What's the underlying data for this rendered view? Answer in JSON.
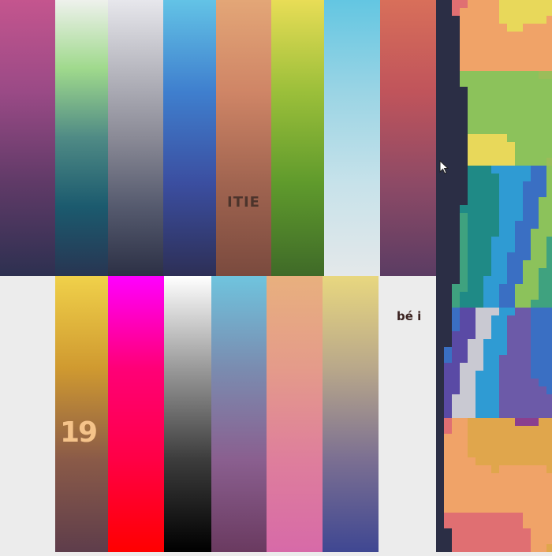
{
  "top_row": [
    {
      "name": "strip-1",
      "colors": [
        "#c4558e",
        "#9a4a86",
        "#5f3a67",
        "#2d3050"
      ]
    },
    {
      "name": "strip-2",
      "colors": [
        "#eef1ec",
        "#9fd98c",
        "#4f8a85",
        "#1b5a6e",
        "#283552"
      ]
    },
    {
      "name": "strip-3",
      "colors": [
        "#e7e7ec",
        "#b8b8c0",
        "#8a8a96",
        "#555a6e",
        "#2c3045"
      ]
    },
    {
      "name": "strip-4",
      "colors": [
        "#63c3e6",
        "#3f7fce",
        "#3b4ea0",
        "#2d2f56"
      ]
    },
    {
      "name": "strip-5",
      "colors": [
        "#e3a677",
        "#cf8566",
        "#a06450",
        "#7a4a3e"
      ]
    },
    {
      "name": "strip-6",
      "colors": [
        "#e8dd56",
        "#9bbf3a",
        "#5f9a2c",
        "#3f6a28"
      ]
    },
    {
      "name": "strip-7",
      "colors": [
        "#63c6e2",
        "#9ad4e4",
        "#c7e2ea",
        "#e4e8ea"
      ]
    },
    {
      "name": "strip-8",
      "colors": [
        "#d86f5a",
        "#c0545b",
        "#8d4a66",
        "#5b3c63"
      ]
    }
  ],
  "bottom_row": [
    {
      "name": "strip-9",
      "colors": [
        "#ececec",
        "#ececec"
      ]
    },
    {
      "name": "strip-10",
      "colors": [
        "#f0d14a",
        "#d09a30",
        "#8a5a48",
        "#5e3d4b"
      ]
    },
    {
      "name": "strip-11",
      "colors": [
        "#ff00ff",
        "#ff0077",
        "#ff0045",
        "#ff0000"
      ]
    },
    {
      "name": "strip-12",
      "colors": [
        "#ffffff",
        "#9a9a9a",
        "#3c3c3c",
        "#000000"
      ]
    },
    {
      "name": "strip-13",
      "colors": [
        "#6fc4de",
        "#7a8cb0",
        "#8a5f8f",
        "#6a3a60"
      ]
    },
    {
      "name": "strip-14",
      "colors": [
        "#e8b07e",
        "#e49b8a",
        "#de7e9c",
        "#d76aa8"
      ]
    },
    {
      "name": "strip-15",
      "colors": [
        "#e8d77f",
        "#b9a88a",
        "#7b6f92",
        "#3f4792"
      ]
    },
    {
      "name": "strip-16",
      "colors": [
        "#ececec",
        "#ececec"
      ]
    }
  ],
  "mosaic_palette": [
    "#2b2e45",
    "#e0a64c",
    "#e8d85a",
    "#8cc25b",
    "#3fa27f",
    "#1f8a86",
    "#2f9bd3",
    "#3a6fc3",
    "#5a4aa5",
    "#8a3f8f",
    "#d85c8a",
    "#e06f72",
    "#f0a368",
    "#9bbd5a",
    "#c9c9d2",
    "#6c5aa8"
  ],
  "annotations": {
    "top_center_mark": "ITIE",
    "bottom_left_mark": "19",
    "right_mark": "bé ⅰ"
  }
}
